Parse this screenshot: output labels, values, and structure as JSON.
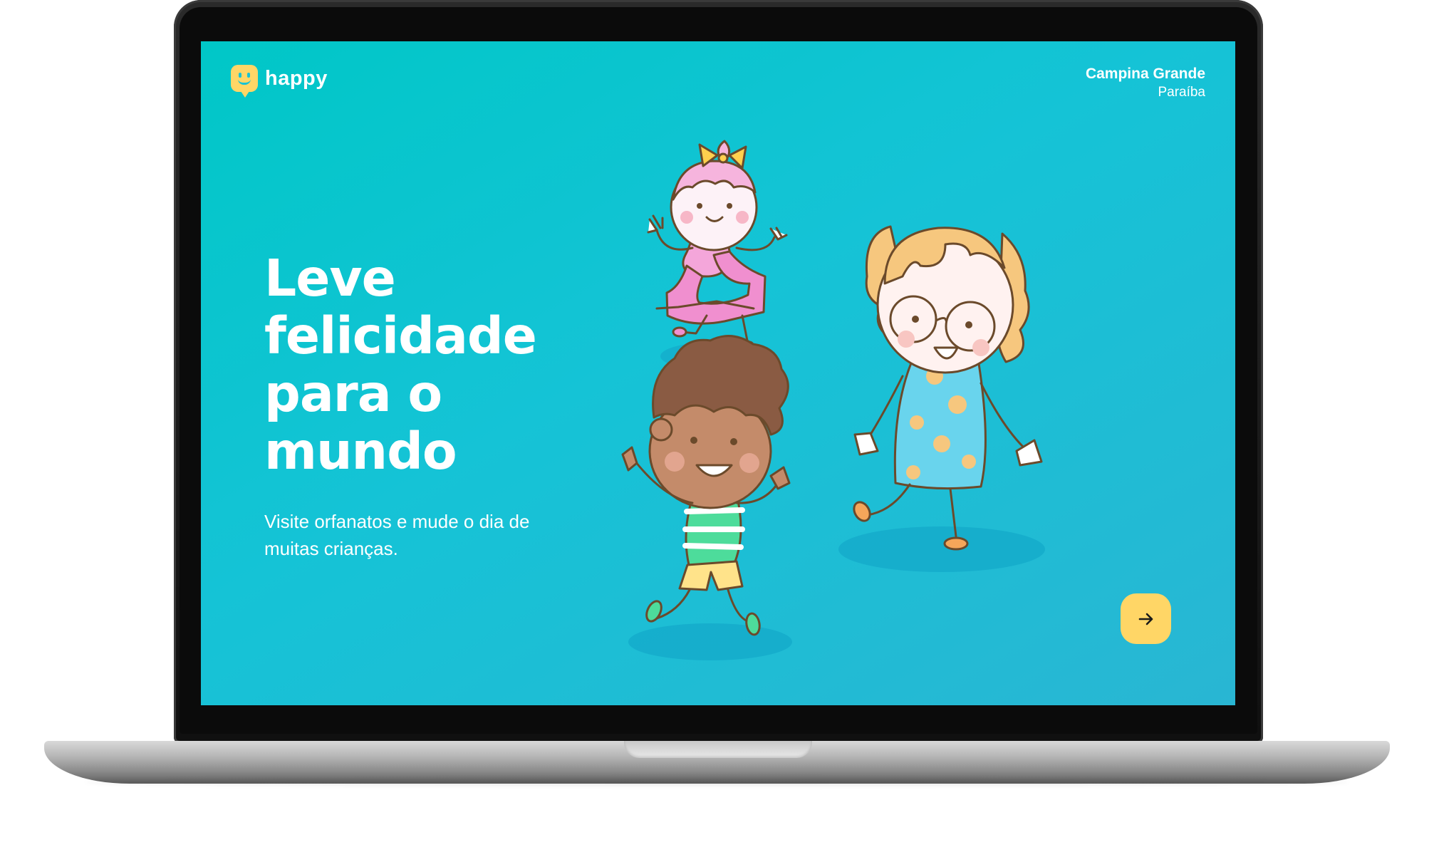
{
  "header": {
    "logo_text": "happy",
    "location_city": "Campina Grande",
    "location_state": "Paraíba"
  },
  "hero": {
    "title": "Leve felicidade para o mundo",
    "subtitle": "Visite orfanatos e mude o dia de muitas crianças."
  },
  "actions": {
    "enter_icon": "arrow-right-icon"
  },
  "illustration": {
    "subject": "children-playing-illustration"
  },
  "colors": {
    "background_start": "#00c7c7",
    "background_end": "#29b6d3",
    "accent": "#ffd666",
    "text": "#ffffff"
  }
}
